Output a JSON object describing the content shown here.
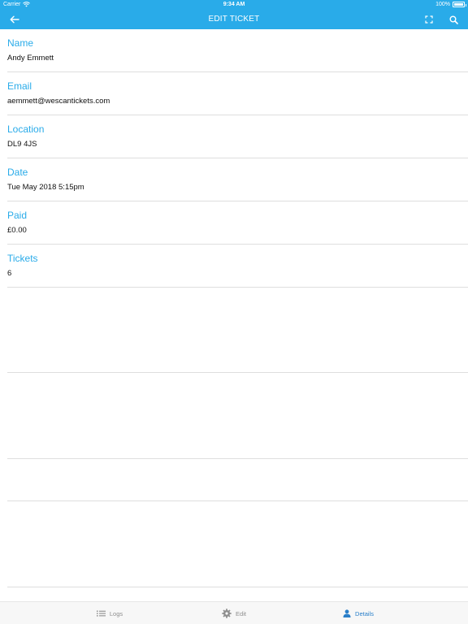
{
  "status_bar": {
    "carrier": "Carrier",
    "time": "9:34 AM",
    "battery": "100%"
  },
  "nav": {
    "title": "EDIT TICKET",
    "icons": [
      "arrow-left-icon",
      "expand-icon",
      "search-icon"
    ]
  },
  "fields": [
    {
      "label": "Name",
      "value": "Andy Emmett"
    },
    {
      "label": "Email",
      "value": "aemmett@wescantickets.com"
    },
    {
      "label": "Location",
      "value": "DL9 4JS"
    },
    {
      "label": "Date",
      "value": "Tue May 2018 5:15pm"
    },
    {
      "label": "Paid",
      "value": "£0.00"
    },
    {
      "label": "Tickets",
      "value": "6"
    }
  ],
  "tabs": [
    {
      "label": "Logs",
      "icon": "list-icon",
      "active": false
    },
    {
      "label": "Edit",
      "icon": "gear-icon",
      "active": false
    },
    {
      "label": "Details",
      "icon": "person-icon",
      "active": true
    }
  ],
  "colors": {
    "accent": "#29abe9",
    "active_tab": "#2a7fc9",
    "inactive_tab": "#8e8e8e",
    "divider": "#dedede"
  }
}
